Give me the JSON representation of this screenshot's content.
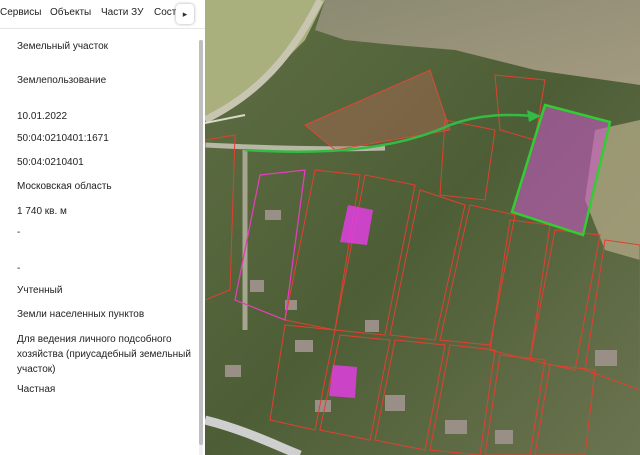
{
  "tabs": [
    {
      "label": "Сервисы"
    },
    {
      "label": "Объекты"
    },
    {
      "label": "Части ЗУ"
    },
    {
      "label": "Соста"
    }
  ],
  "tab_next_glyph": "▸",
  "fields": [
    {
      "value": "Земельный участок"
    },
    {
      "value": "Землепользование"
    },
    {
      "value": "10.01.2022"
    },
    {
      "value": "50:04:0210401:1671"
    },
    {
      "value": "50:04:0210401"
    },
    {
      "value": "Московская область"
    },
    {
      "value": "1 740 кв. м"
    },
    {
      "value": "-"
    },
    {
      "value": "-"
    },
    {
      "value": "Учтенный"
    },
    {
      "value": "Земли населенных пунктов"
    },
    {
      "value": "Для ведения личного подсобного хозяйства (приусадебный земельный участок)"
    },
    {
      "value": "Частная"
    }
  ],
  "map": {
    "colors": {
      "parcel_border": "#e04030",
      "highlight_border": "#33cc33",
      "highlight_fill": "#cc55cc",
      "building_fill": "#e040e0",
      "arrow": "#33bb44"
    }
  }
}
